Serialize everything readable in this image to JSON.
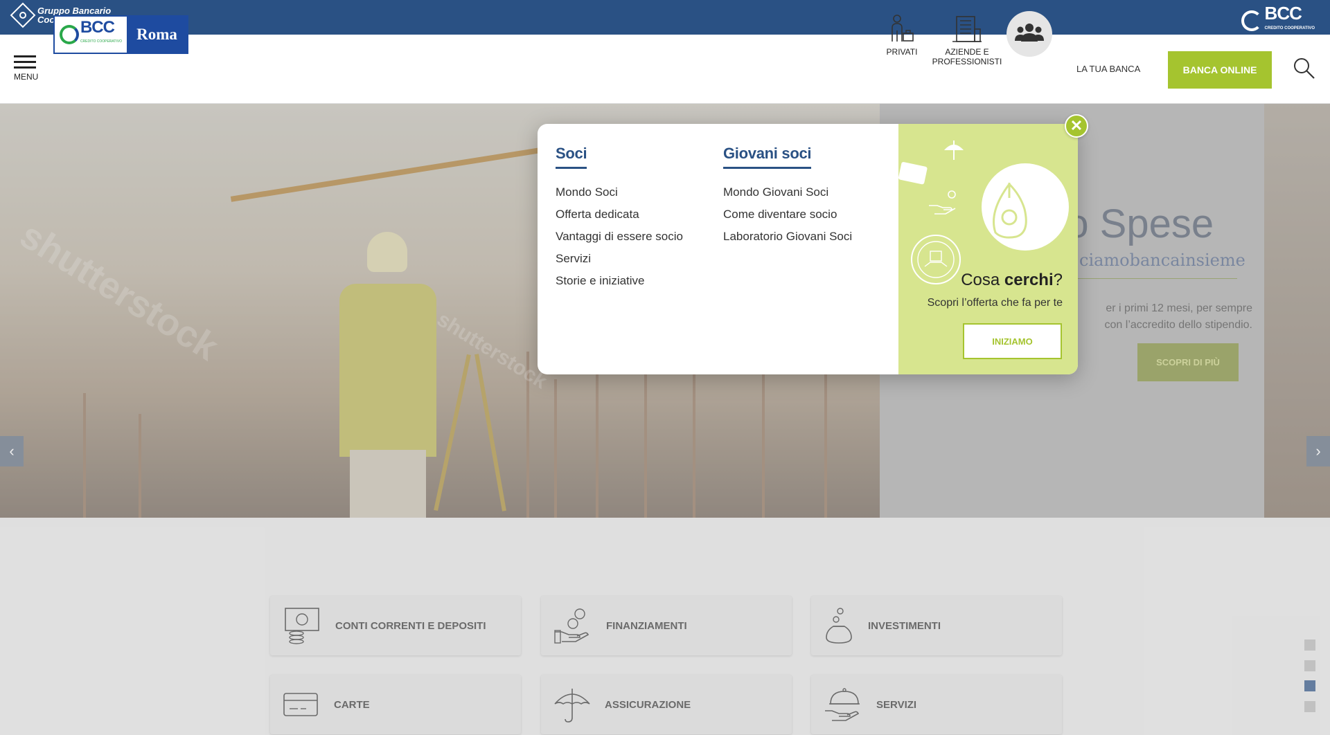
{
  "topbar": {
    "group_name_line1": "Gruppo Bancario",
    "group_name_line2": "Cooperativo Iccrea",
    "brand": "BCC",
    "brand_sub": "CREDITO COOPERATIVO"
  },
  "header": {
    "menu_label": "MENU",
    "logo_brand": "BCC",
    "logo_brand_sub": "CREDITO COOPERATIVO",
    "logo_city": "Roma",
    "segments": [
      {
        "label": "PRIVATI",
        "icon": "person-briefcase-icon"
      },
      {
        "label": "AZIENDE E PROFESSIONISTI",
        "icon": "building-icon"
      },
      {
        "label": "",
        "icon": "group-users-icon"
      }
    ],
    "tua_banca": "LA TUA BANCA",
    "banca_online": "BANCA ONLINE",
    "search_icon": "search-icon"
  },
  "hero": {
    "title": "ro Spese",
    "subtitle": "ciamobancainsieme",
    "text_line1": "er i primi 12 mesi, per sempre",
    "text_line2": "con l’accredito dello stipendio.",
    "cta": "SCOPRI DI PIÙ",
    "prev_icon": "chevron-left-icon",
    "next_icon": "chevron-right-icon"
  },
  "popup": {
    "soci": {
      "title": "Soci",
      "items": [
        "Mondo Soci",
        "Offerta dedicata",
        "Vantaggi di essere socio",
        "Servizi",
        "Storie e iniziative"
      ]
    },
    "giovani": {
      "title": "Giovani soci",
      "items": [
        "Mondo Giovani Soci",
        "Come diventare socio",
        "Laboratorio Giovani Soci"
      ]
    },
    "promo": {
      "title_prefix": "Cosa ",
      "title_bold": "cerchi",
      "title_suffix": "?",
      "subtitle": "Scopri l’offerta che fa per te",
      "cta": "INIZIAMO"
    },
    "close_icon": "close-icon"
  },
  "products": [
    {
      "label": "CONTI CORRENTI E DEPOSITI",
      "icon": "cash-coins-icon"
    },
    {
      "label": "FINANZIAMENTI",
      "icon": "hand-euro-icon"
    },
    {
      "label": "INVESTIMENTI",
      "icon": "money-bag-icon"
    },
    {
      "label": "CARTE",
      "icon": "card-icon"
    },
    {
      "label": "ASSICURAZIONE",
      "icon": "umbrella-icon"
    },
    {
      "label": "SERVIZI",
      "icon": "service-bell-icon"
    }
  ],
  "pager": {
    "count": 4,
    "active_index": 2
  },
  "colors": {
    "primary_blue": "#2a5184",
    "accent_green": "#a5c42f",
    "promo_bg": "#d7e58f"
  }
}
